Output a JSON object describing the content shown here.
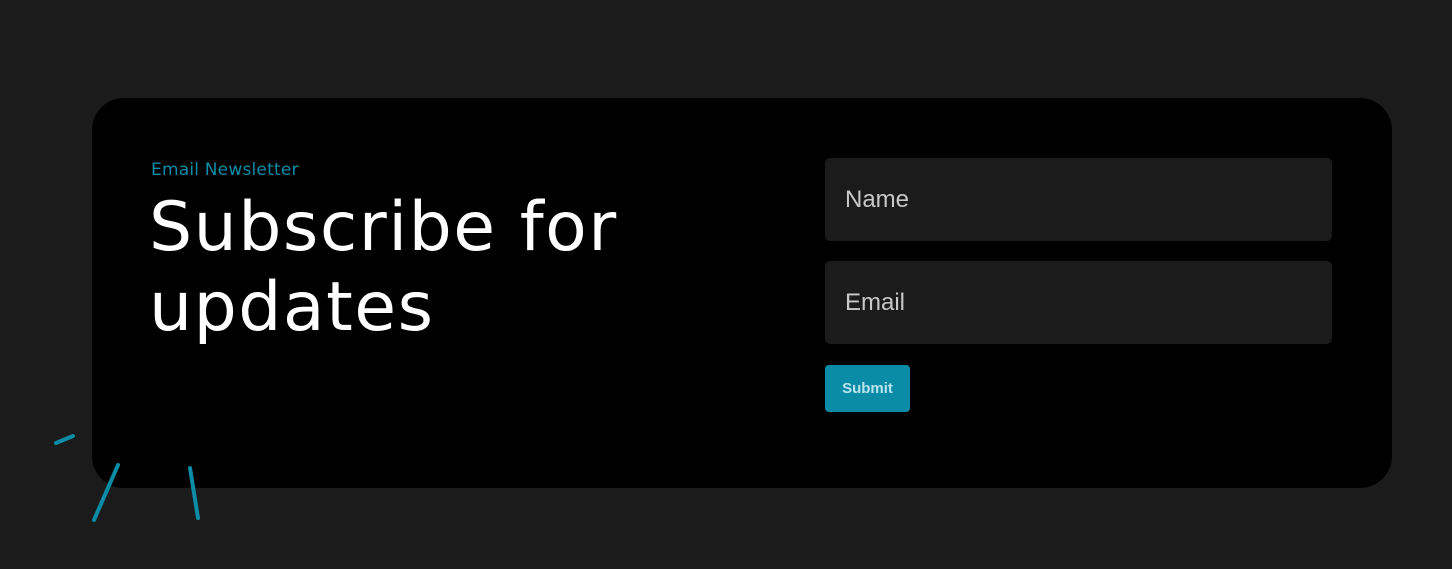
{
  "newsletter": {
    "eyebrow": "Email Newsletter",
    "headline": "Subscribe for updates"
  },
  "form": {
    "name_placeholder": "Name",
    "email_placeholder": "Email",
    "submit_label": "Submit"
  },
  "colors": {
    "page_background": "#1b1b1b",
    "card_background": "#000000",
    "accent": "#0b8ca6",
    "input_background": "#1b1b1b",
    "headline_text": "#ffffff"
  },
  "decorations": {
    "icon": "accent-dash-marks"
  }
}
